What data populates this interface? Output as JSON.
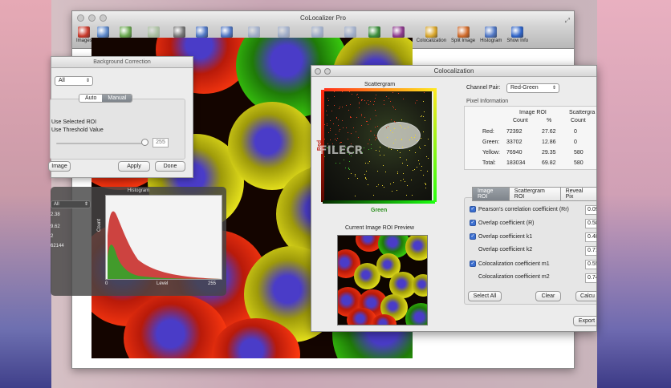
{
  "main_window": {
    "title": "CoLocalizer Pro",
    "toolbar": [
      {
        "label": "Images",
        "icon": "images-icon",
        "color": "#c8392b",
        "enabled": true
      },
      {
        "label": "Open",
        "icon": "open-icon",
        "color": "#5c87c9",
        "enabled": true
      },
      {
        "label": "Fit To View",
        "icon": "fit-to-view-icon",
        "color": "#6aa84f",
        "enabled": true
      },
      {
        "label": "Actual Size",
        "icon": "actual-size-icon",
        "color": "#6aa84f",
        "enabled": false
      },
      {
        "label": "Save As",
        "icon": "save-as-icon",
        "color": "#777777",
        "enabled": true
      },
      {
        "label": "Zoom In",
        "icon": "zoom-in-icon",
        "color": "#4f76c4",
        "enabled": true
      },
      {
        "label": "Zoom Out",
        "icon": "zoom-out-icon",
        "color": "#4f76c4",
        "enabled": true
      },
      {
        "label": "Rotate Left",
        "icon": "rotate-left-icon",
        "color": "#4f76c4",
        "enabled": false
      },
      {
        "label": "Rotate Right",
        "icon": "rotate-right-icon",
        "color": "#4f76c4",
        "enabled": false
      },
      {
        "label": "Flip Horizontal",
        "icon": "flip-horizontal-icon",
        "color": "#4f76c4",
        "enabled": false
      },
      {
        "label": "Flip Vertical",
        "icon": "flip-vertical-icon",
        "color": "#4f76c4",
        "enabled": false
      },
      {
        "label": "Merge",
        "icon": "merge-icon",
        "color": "#3d8f3d",
        "enabled": true
      },
      {
        "label": "Background",
        "icon": "background-icon",
        "color": "#8e3a8e",
        "enabled": true
      },
      {
        "label": "Colocalization",
        "icon": "colocalization-icon",
        "color": "#d9a62b",
        "enabled": true
      },
      {
        "label": "Split Image",
        "icon": "split-image-icon",
        "color": "#d06a2a",
        "enabled": true
      },
      {
        "label": "Histogram",
        "icon": "histogram-icon",
        "color": "#4f76c4",
        "enabled": true
      },
      {
        "label": "Show Info",
        "icon": "show-info-icon",
        "color": "#2f64c8",
        "enabled": true
      }
    ]
  },
  "background_correction": {
    "title": "Background Correction",
    "channel_select": "All",
    "mode_tabs": [
      "Auto",
      "Manual"
    ],
    "active_mode": "Manual",
    "option1": "Use Selected ROI",
    "option2": "Use Threshold Value",
    "threshold_value": "255",
    "threshold_level": 1.0,
    "buttons": {
      "image": "Image",
      "apply": "Apply",
      "done": "Done"
    }
  },
  "histogram": {
    "title": "Histogram",
    "channel_select": "All",
    "stats": [
      "2.38",
      "9.62",
      "2",
      "62144"
    ],
    "ylabel": "Count",
    "xlabel": "Level",
    "x_min": "0",
    "x_max": "255"
  },
  "colocalization": {
    "title": "Colocalization",
    "scattergram_label": "Scattergram",
    "axis_red": "Red",
    "axis_green": "Green",
    "channel_pair_label": "Channel Pair:",
    "channel_pair_value": "Red-Green",
    "pixel_info_label": "Pixel Information",
    "pixel_table": {
      "group_image_roi": "Image ROI",
      "group_scattergram": "Scattergra",
      "col_count": "Count",
      "col_pct": "%",
      "col_count2": "Count",
      "rows": [
        {
          "label": "Red:",
          "count": "72392",
          "pct": "27.62",
          "count2": "0"
        },
        {
          "label": "Green:",
          "count": "33702",
          "pct": "12.86",
          "count2": "0"
        },
        {
          "label": "Yellow:",
          "count": "76940",
          "pct": "29.35",
          "count2": "580"
        },
        {
          "label": "Total:",
          "count": "183034",
          "pct": "69.82",
          "count2": "580"
        }
      ]
    },
    "tabs": [
      "Image ROI",
      "Scattergram ROI",
      "Reveal Pix"
    ],
    "active_tab": "Image ROI",
    "coefficients": [
      {
        "label": "Pearson's correlation coefficient (Rr)",
        "checked": true,
        "value": "0.09"
      },
      {
        "label": "Overlap coefficient (R)",
        "checked": true,
        "value": "0.58"
      },
      {
        "label": "Overlap coefficient k1",
        "checked": true,
        "value": "0.48"
      },
      {
        "label": "Overlap coefficient k2",
        "checked": false,
        "value": "0.71"
      },
      {
        "label": "Colocalization coefficient m1",
        "checked": true,
        "value": "0.55"
      },
      {
        "label": "Colocalization coefficient m2",
        "checked": false,
        "value": "0.74"
      }
    ],
    "buttons": {
      "select_all": "Select All",
      "clear": "Clear",
      "calc": "Calcu",
      "export": "Export"
    },
    "preview_label": "Current Image ROI Preview"
  },
  "watermark": "FILECR"
}
